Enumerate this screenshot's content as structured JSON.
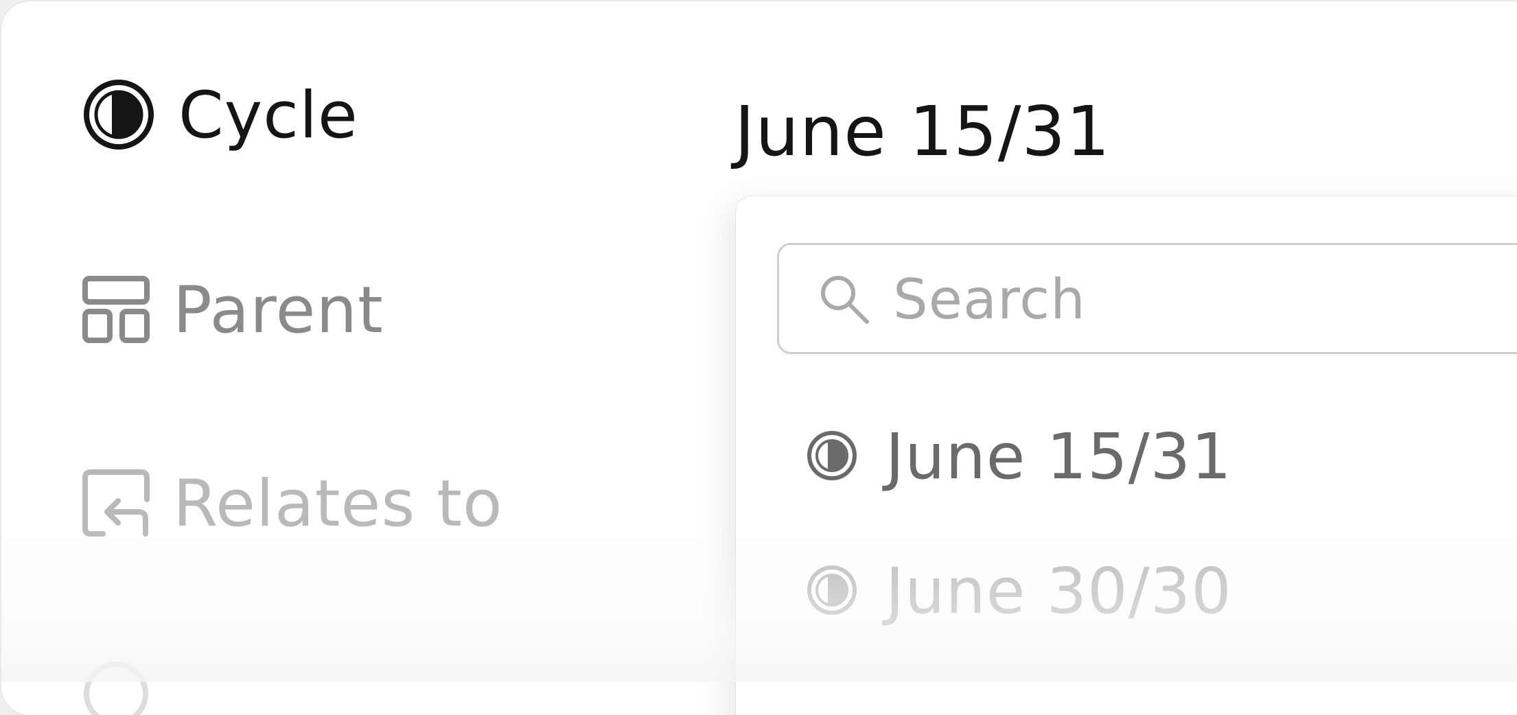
{
  "properties": {
    "cycle_label": "Cycle",
    "parent_label": "Parent",
    "relates_label": "Relates to",
    "cycle_value": "June 15/31"
  },
  "icons": {
    "cycle": "half-filled-circle-icon",
    "parent": "layout-blocks-icon",
    "relates": "relation-arrow-icon",
    "search": "search-icon"
  },
  "dropdown": {
    "search_placeholder": "Search",
    "options": [
      {
        "label": "June 15/31",
        "icon": "half-filled-circle-icon"
      },
      {
        "label": "June 30/30",
        "icon": "half-filled-circle-icon"
      }
    ]
  },
  "colors": {
    "primary_text": "#151515",
    "secondary_text": "#8a8a8a",
    "muted_text": "#b9b9b9",
    "border": "#cfcfcf"
  }
}
